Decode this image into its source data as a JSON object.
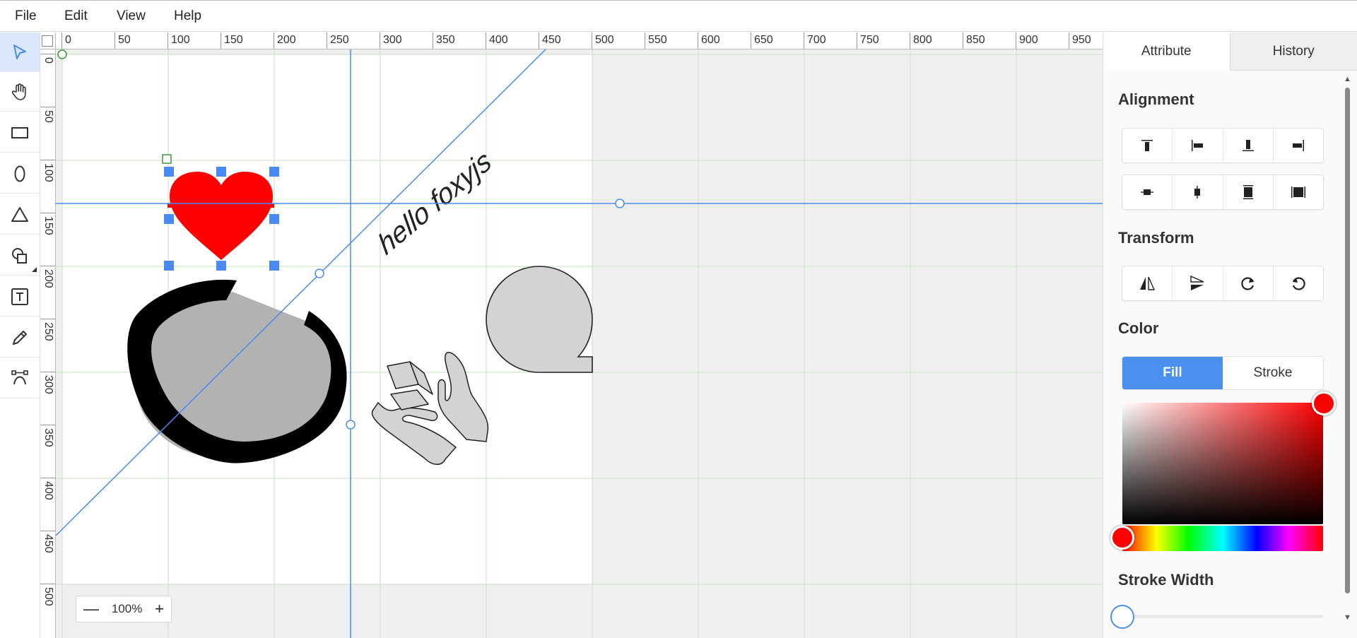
{
  "menubar": {
    "items": [
      "File",
      "Edit",
      "View",
      "Help"
    ]
  },
  "toolbar": {
    "tools": [
      {
        "name": "select-tool",
        "icon": "cursor-arrow-icon",
        "active": true
      },
      {
        "name": "pan-tool",
        "icon": "hand-icon",
        "active": false
      },
      {
        "name": "rectangle-tool",
        "icon": "rectangle-icon",
        "active": false
      },
      {
        "name": "ellipse-tool",
        "icon": "ellipse-icon",
        "active": false
      },
      {
        "name": "triangle-tool",
        "icon": "triangle-icon",
        "active": false
      },
      {
        "name": "shapes-tool",
        "icon": "shapes-icon",
        "active": false
      },
      {
        "name": "text-tool",
        "icon": "text-icon",
        "active": false
      },
      {
        "name": "pencil-tool",
        "icon": "pencil-icon",
        "active": false
      },
      {
        "name": "path-tool",
        "icon": "bezier-path-icon",
        "active": false
      }
    ]
  },
  "rulers": {
    "top_labels": [
      "0",
      "50",
      "100",
      "150",
      "200",
      "250",
      "300",
      "350",
      "400",
      "450",
      "500",
      "550",
      "600",
      "650",
      "700",
      "750",
      "800",
      "850",
      "900",
      "950"
    ],
    "left_labels": [
      "0",
      "50",
      "100",
      "150",
      "200",
      "250",
      "300",
      "350",
      "400",
      "450",
      "500"
    ]
  },
  "canvas": {
    "text_object": "hello foxyjs",
    "accent_color": "#4a8af4",
    "heart_color": "#ff0000",
    "shape_gray": "#d3d3d3",
    "blob_fill": "#b2b2b2"
  },
  "zoom": {
    "minus": "—",
    "value": "100%",
    "plus": "+"
  },
  "panel": {
    "tabs": {
      "attribute": "Attribute",
      "history": "History"
    },
    "alignment_title": "Alignment",
    "transform_title": "Transform",
    "color_title": "Color",
    "color_modes": {
      "fill": "Fill",
      "stroke": "Stroke"
    },
    "selected_color": "#ff0000",
    "stroke_width_title": "Stroke Width",
    "stroke_width_value": 0
  }
}
